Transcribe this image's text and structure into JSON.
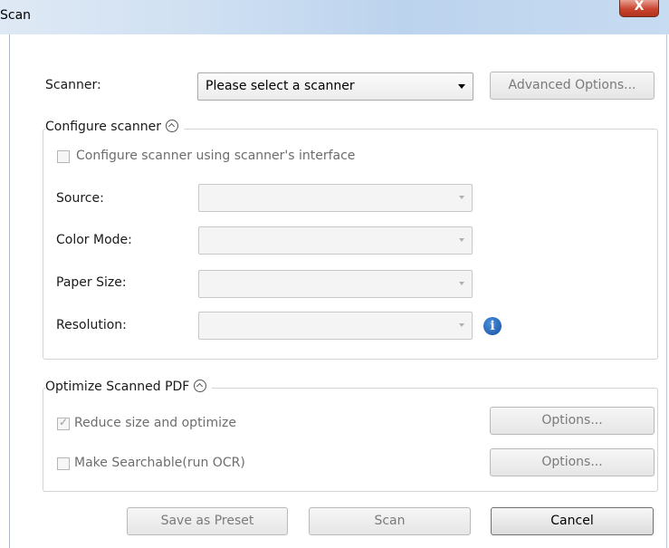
{
  "window": {
    "title": "Scan",
    "close_glyph": "X"
  },
  "scanner": {
    "label": "Scanner:",
    "selected": "Please select a scanner",
    "advanced_label": "Advanced Options..."
  },
  "configure": {
    "title": "Configure scanner",
    "use_interface_label": "Configure scanner using scanner's interface",
    "use_interface_checked": false,
    "source_label": "Source:",
    "color_mode_label": "Color Mode:",
    "paper_size_label": "Paper Size:",
    "resolution_label": "Resolution:",
    "info_glyph": "i"
  },
  "optimize": {
    "title": "Optimize Scanned PDF",
    "reduce_label": "Reduce size and optimize",
    "reduce_checked": true,
    "searchable_label": "Make Searchable(run OCR)",
    "searchable_checked": false,
    "options_label": "Options..."
  },
  "footer": {
    "save_preset_label": "Save as Preset",
    "scan_label": "Scan",
    "cancel_label": "Cancel"
  },
  "icons": {
    "collapse": "chevron-up-circle-icon",
    "info": "info-icon",
    "close": "close-icon",
    "dropdown": "chevron-down-icon"
  }
}
